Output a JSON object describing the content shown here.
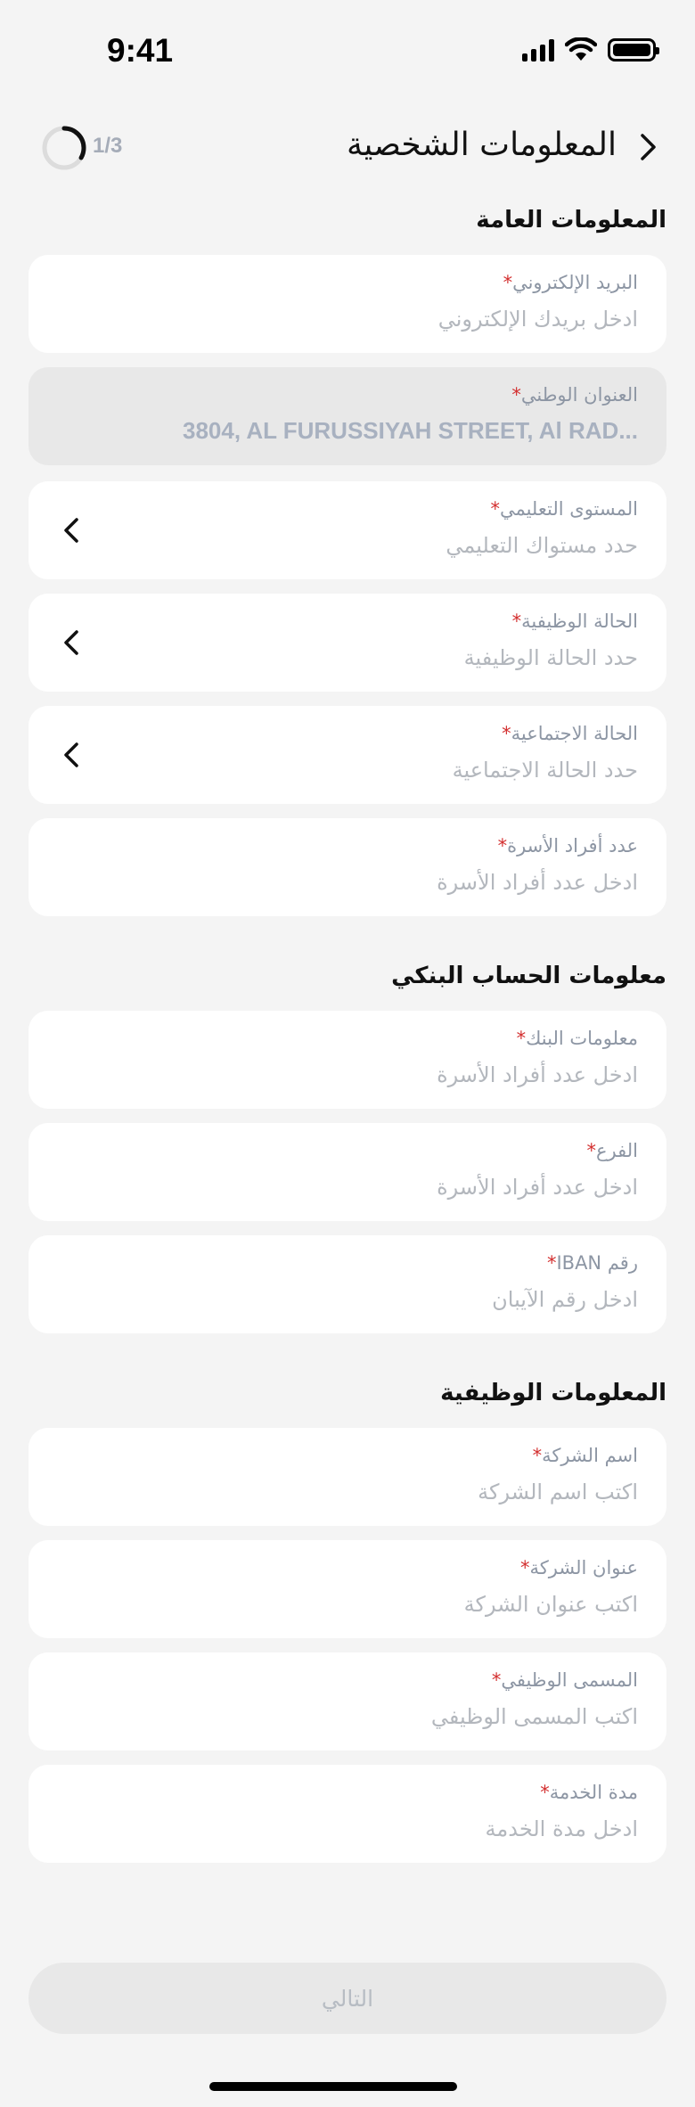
{
  "status_bar": {
    "time": "9:41"
  },
  "header": {
    "title": "المعلومات الشخصية",
    "step_text": "1/3",
    "progress_fraction": 0.333
  },
  "sections": {
    "general": {
      "title": "المعلومات العامة"
    },
    "bank": {
      "title": "معلومات الحساب البنكي"
    },
    "job": {
      "title": "المعلومات الوظيفية"
    }
  },
  "fields": {
    "email": {
      "label": "البريد الإلكتروني",
      "placeholder": "ادخل بريدك الإلكتروني"
    },
    "national_address": {
      "label": "العنوان الوطني",
      "value": "3804, AL FURUSSIYAH STREET, Al RAD..."
    },
    "education": {
      "label": "المستوى التعليمي",
      "placeholder": "حدد مستواك التعليمي"
    },
    "employment_status": {
      "label": "الحالة الوظيفية",
      "placeholder": "حدد الحالة الوظيفية"
    },
    "marital_status": {
      "label": "الحالة الاجتماعية",
      "placeholder": "حدد الحالة الاجتماعية"
    },
    "family_members": {
      "label": "عدد أفراد الأسرة",
      "placeholder": "ادخل عدد أفراد الأسرة"
    },
    "bank_info": {
      "label": "معلومات البنك",
      "placeholder": "ادخل عدد أفراد الأسرة"
    },
    "branch": {
      "label": "الفرع",
      "placeholder": "ادخل عدد أفراد الأسرة"
    },
    "iban": {
      "label": "رقم IBAN",
      "placeholder": "ادخل رقم الآيبان"
    },
    "company_name": {
      "label": "اسم الشركة",
      "placeholder": "اكتب اسم الشركة"
    },
    "company_address": {
      "label": "عنوان الشركة",
      "placeholder": "اكتب عنوان الشركة"
    },
    "job_title": {
      "label": "المسمى الوظيفي",
      "placeholder": "اكتب المسمى الوظيفي"
    },
    "service_duration": {
      "label": "مدة الخدمة",
      "placeholder": "ادخل مدة الخدمة"
    }
  },
  "required_marker": "*",
  "next_button": {
    "label": "التالي"
  },
  "colors": {
    "required": "#d32f2f",
    "label": "#8d96a4",
    "placeholder": "#b3b7bd",
    "background": "#f4f4f4"
  }
}
